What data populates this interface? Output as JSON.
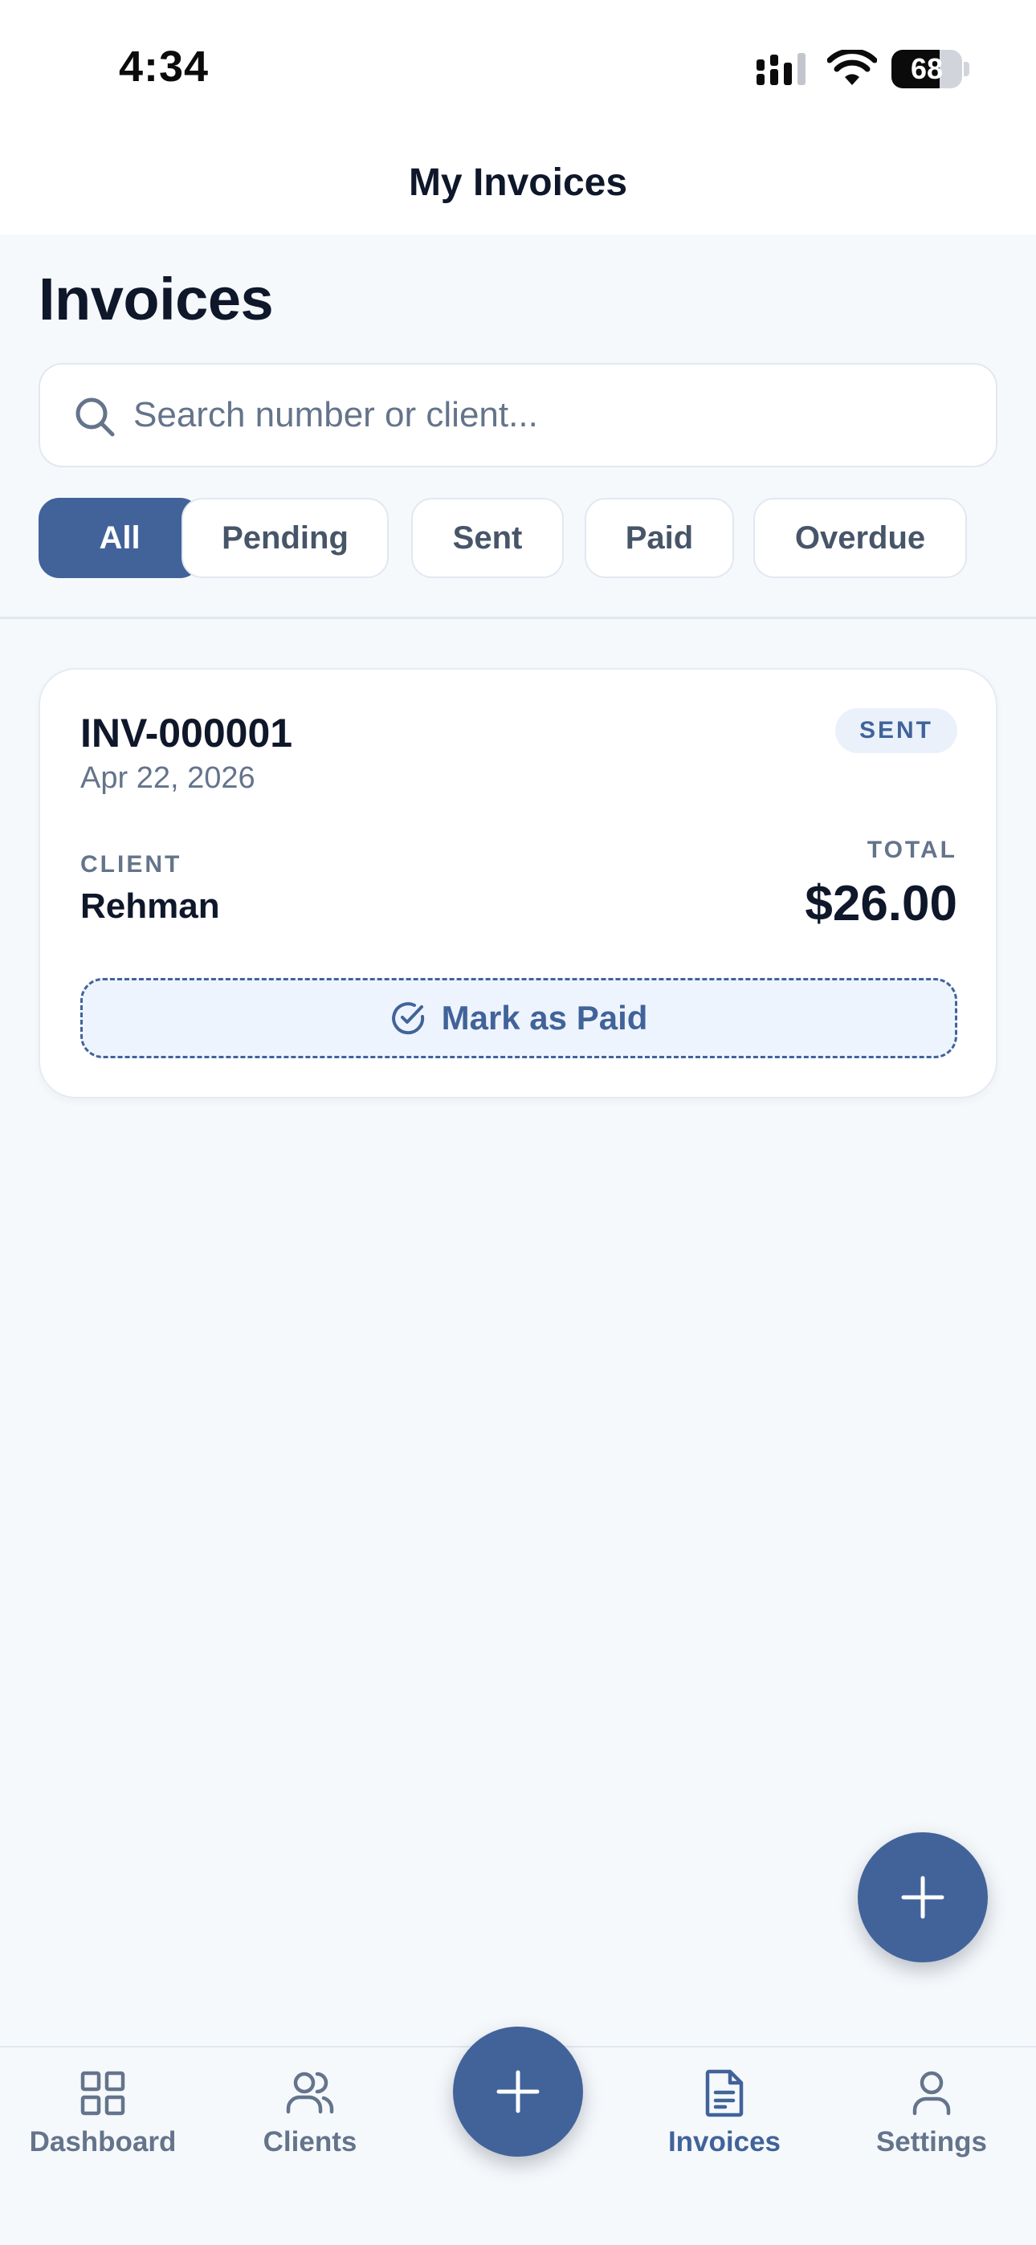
{
  "status_bar": {
    "time": "4:34",
    "battery_level": "68",
    "battery_fraction": 0.68
  },
  "header": {
    "title": "My Invoices"
  },
  "page": {
    "title": "Invoices"
  },
  "search": {
    "placeholder": "Search number or client...",
    "value": ""
  },
  "filters": {
    "options": [
      "All",
      "Pending",
      "Sent",
      "Paid",
      "Overdue"
    ],
    "selected": "All"
  },
  "invoices": [
    {
      "number": "INV-000001",
      "date": "Apr 22, 2026",
      "status": "SENT",
      "client_label": "CLIENT",
      "client": "Rehman",
      "total_label": "TOTAL",
      "total": "$26.00",
      "action_label": "Mark as Paid"
    }
  ],
  "tabbar": {
    "items": [
      {
        "label": "Dashboard",
        "icon": "grid-icon",
        "active": false
      },
      {
        "label": "Clients",
        "icon": "users-icon",
        "active": false
      },
      {
        "label": "Invoices",
        "icon": "document-icon",
        "active": true
      },
      {
        "label": "Settings",
        "icon": "user-icon",
        "active": false
      }
    ]
  },
  "colors": {
    "accent": "#41639a",
    "background": "#f6f9fc",
    "text_primary": "#0f172a",
    "text_muted": "#64748b"
  }
}
